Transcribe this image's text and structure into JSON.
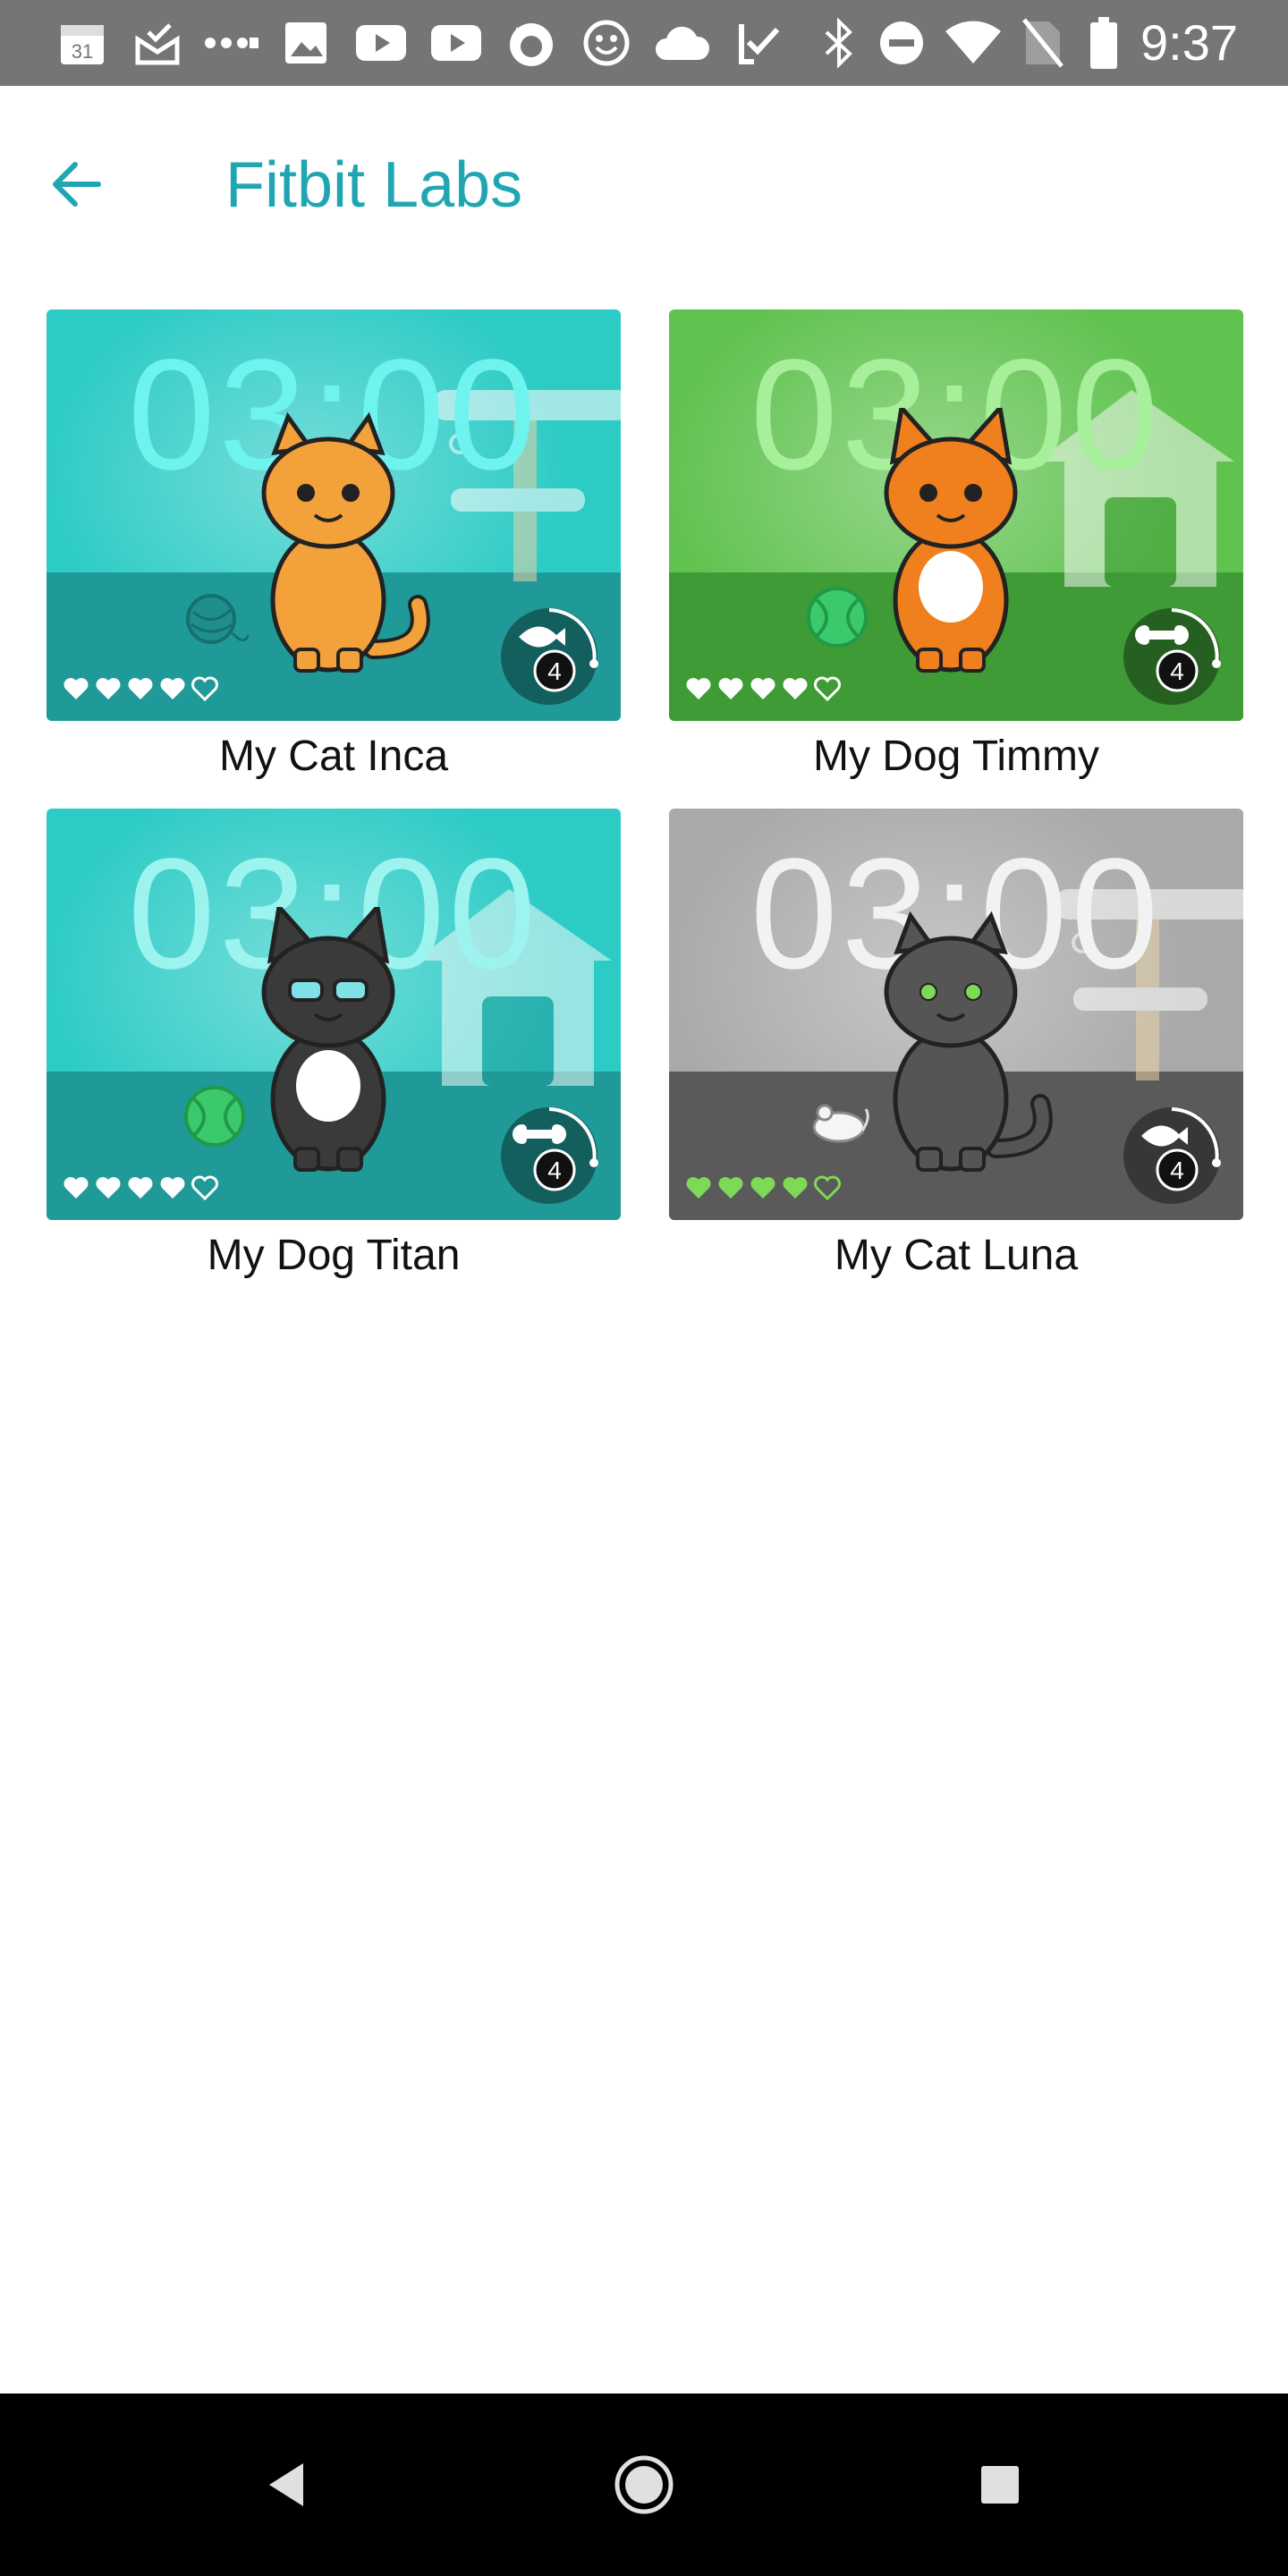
{
  "status_bar": {
    "time": "9:37",
    "calendar_day": "31",
    "icons": [
      "calendar-icon",
      "mail-check-icon",
      "dots-icon",
      "image-icon",
      "youtube-icon",
      "youtube-icon",
      "fox-icon",
      "smiley-icon",
      "cloud-icon",
      "task-icon",
      "bluetooth-icon",
      "dnd-icon",
      "wifi-icon",
      "no-sim-icon",
      "battery-icon"
    ]
  },
  "app_bar": {
    "back_icon": "arrow-left-icon",
    "title": "Fitbit Labs"
  },
  "clockfaces": [
    {
      "name": "My Cat Inca",
      "clock": "03:00",
      "theme": {
        "bg": "#2ccbc6",
        "floor": "#1f9a98",
        "clock": "#6ff3ee",
        "pet": "#f3a23b"
      },
      "hearts_filled": 4,
      "hearts_total": 5,
      "badge_count": "4",
      "pet_icon": "orange-cat-icon",
      "toy_icon": "yarn-ball-icon",
      "badge_icon": "fish-icon"
    },
    {
      "name": "My Dog Timmy",
      "clock": "03:00",
      "theme": {
        "bg": "#60c24f",
        "floor": "#3e9b36",
        "clock": "#a8ef9b",
        "pet": "#f07f1e"
      },
      "hearts_filled": 4,
      "hearts_total": 5,
      "badge_count": "4",
      "pet_icon": "corgi-dog-icon",
      "toy_icon": "tennis-ball-icon",
      "badge_icon": "bone-icon"
    },
    {
      "name": "My Dog Titan",
      "clock": "03:00",
      "theme": {
        "bg": "#2ccbc6",
        "floor": "#1f9a98",
        "clock": "#9df4ef",
        "pet": "#3a3a3a"
      },
      "hearts_filled": 4,
      "hearts_total": 5,
      "badge_count": "4",
      "pet_icon": "husky-dog-icon",
      "toy_icon": "tennis-ball-icon",
      "badge_icon": "bone-icon"
    },
    {
      "name": "My Cat Luna",
      "clock": "03:00",
      "theme": {
        "bg": "#a9a9a9",
        "floor": "#5a5a5a",
        "clock": "#f2f2f2",
        "pet": "#555555"
      },
      "hearts_filled": 4,
      "hearts_total": 5,
      "hearts_color": "#7ed957",
      "badge_count": "4",
      "pet_icon": "gray-cat-icon",
      "toy_icon": "toy-mouse-icon",
      "badge_icon": "fish-icon"
    }
  ],
  "nav_bar": {
    "back": "nav-back-icon",
    "home": "nav-home-icon",
    "recents": "nav-recents-icon"
  },
  "colors": {
    "accent": "#20a6b3",
    "status_bar": "#757575",
    "nav_bar": "#000000"
  }
}
